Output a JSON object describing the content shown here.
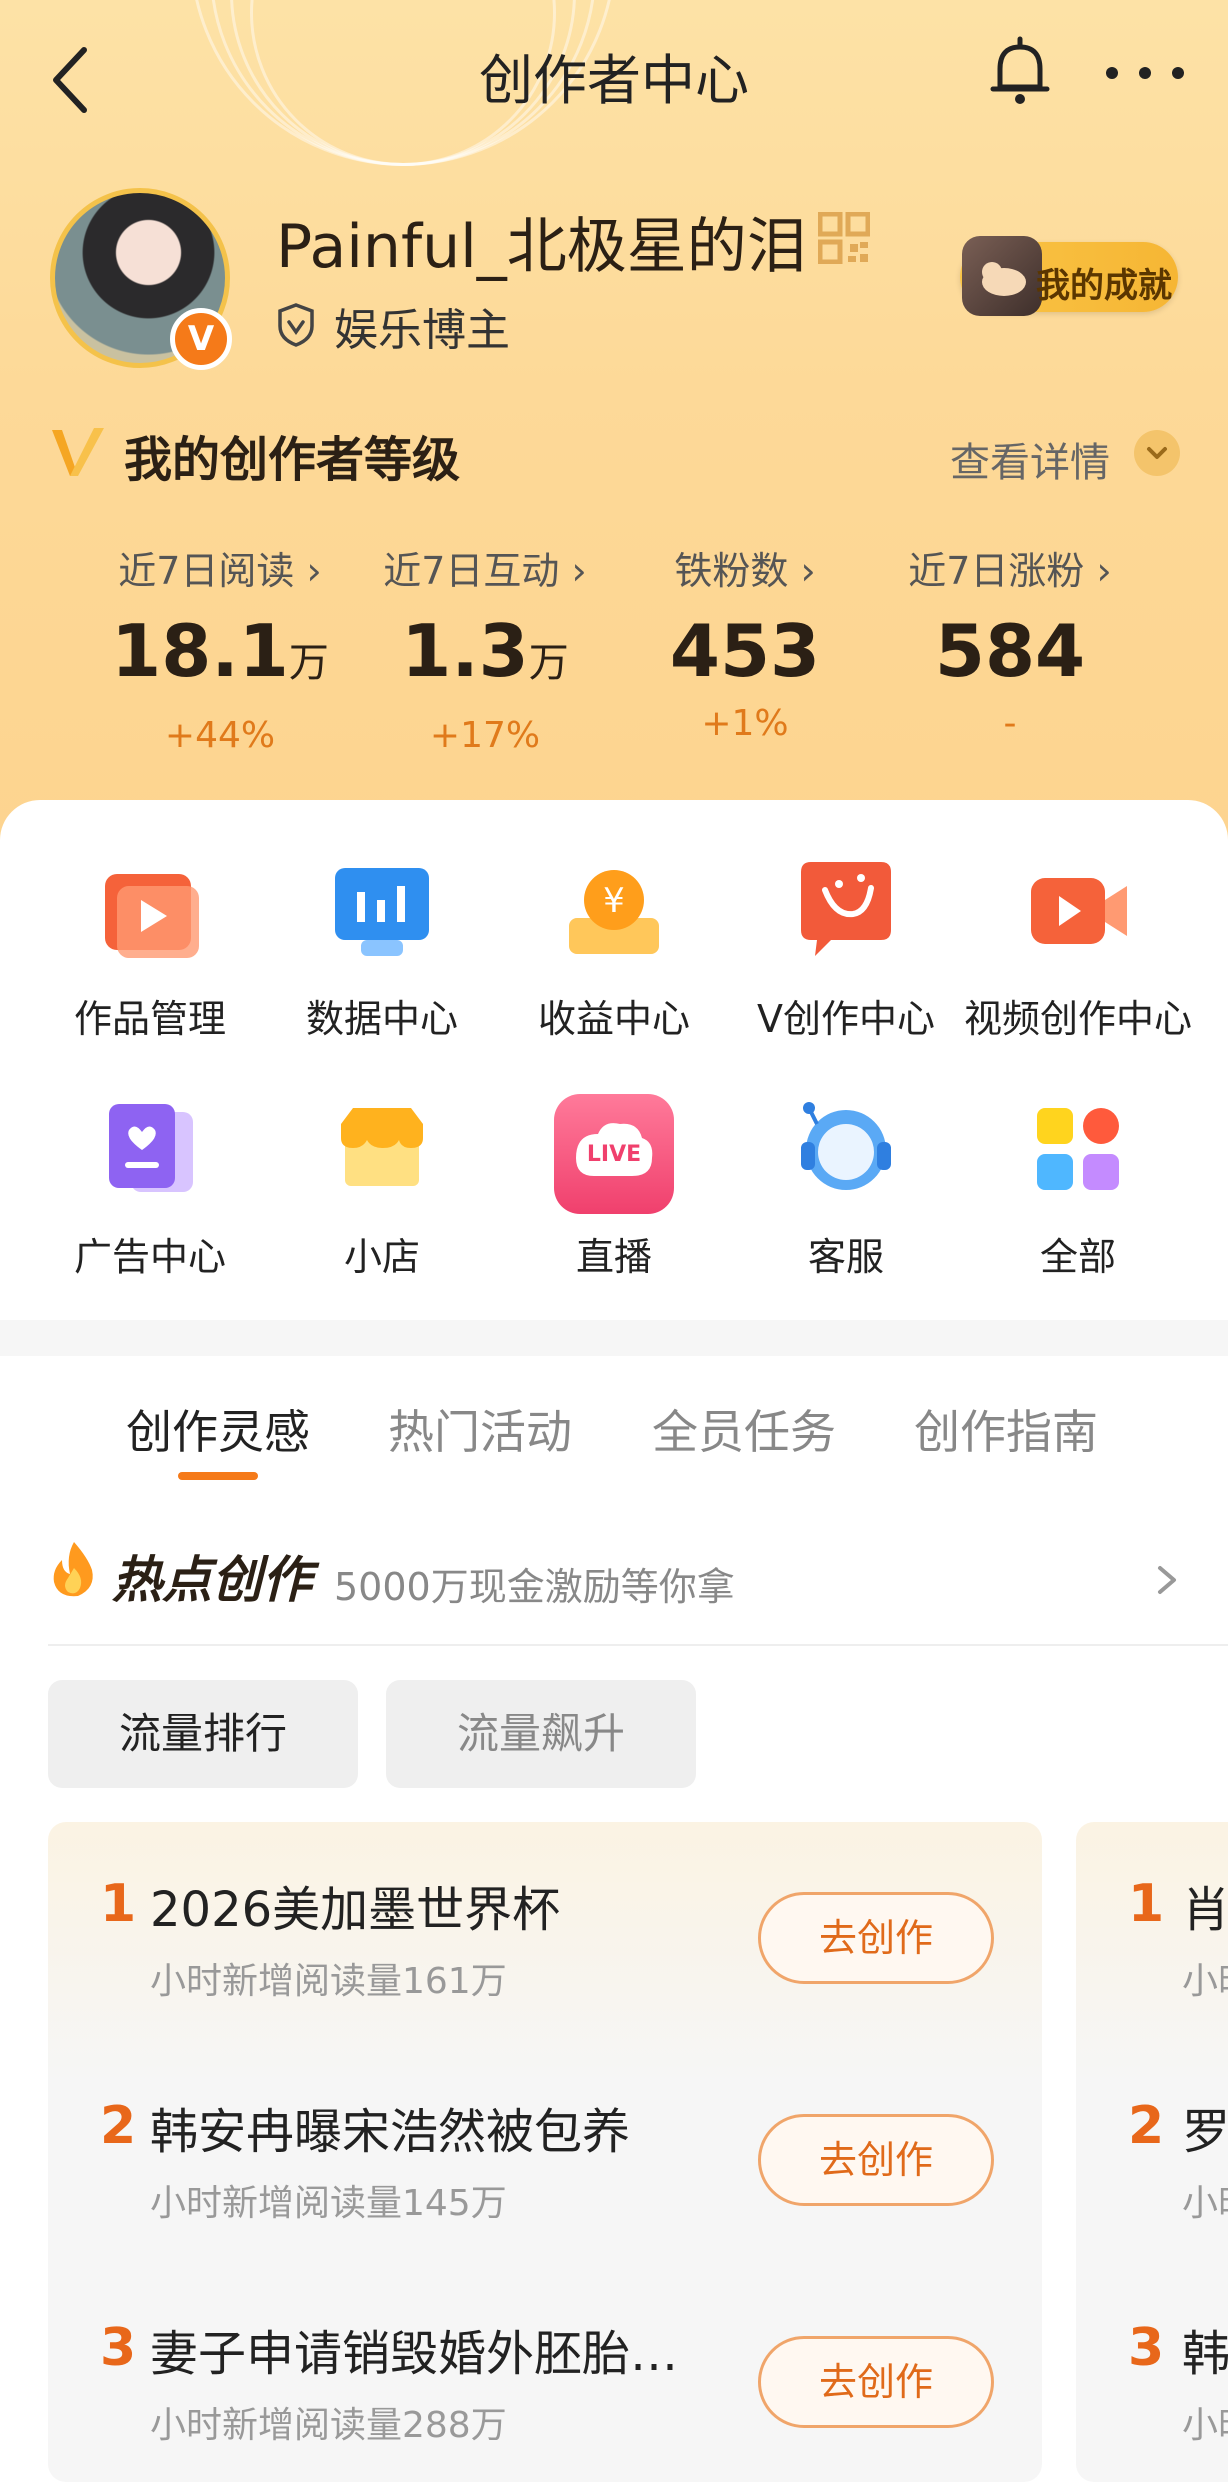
{
  "header": {
    "title": "创作者中心"
  },
  "profile": {
    "username": "Painful_北极星的泪",
    "badge_letter": "V",
    "role": "娱乐博主",
    "achievement_label": "我的成就"
  },
  "level": {
    "title": "我的创作者等级",
    "more_label": "查看详情"
  },
  "stats": [
    {
      "label": "近7日阅读",
      "value": "18.1",
      "unit": "万",
      "change": "+44%"
    },
    {
      "label": "近7日互动",
      "value": "1.3",
      "unit": "万",
      "change": "+17%"
    },
    {
      "label": "铁粉数",
      "value": "453",
      "unit": "",
      "change": "+1%"
    },
    {
      "label": "近7日涨粉",
      "value": "584",
      "unit": "",
      "change": "-"
    }
  ],
  "tools": [
    {
      "label": "作品管理",
      "icon": "play-folder-icon"
    },
    {
      "label": "数据中心",
      "icon": "data-monitor-icon"
    },
    {
      "label": "收益中心",
      "icon": "yen-coin-icon"
    },
    {
      "label": "V创作中心",
      "icon": "sparkle-bubble-icon"
    },
    {
      "label": "视频创作中心",
      "icon": "video-camera-icon"
    },
    {
      "label": "广告中心",
      "icon": "ad-card-icon"
    },
    {
      "label": "小店",
      "icon": "shop-icon"
    },
    {
      "label": "直播",
      "icon": "live-icon"
    },
    {
      "label": "客服",
      "icon": "support-headset-icon"
    },
    {
      "label": "全部",
      "icon": "all-grid-icon"
    }
  ],
  "live_icon_text": "LIVE",
  "tabs": [
    "创作灵感",
    "热门活动",
    "全员任务",
    "创作指南"
  ],
  "hot": {
    "title": "热点创作",
    "subtitle": "5000万现金激励等你拿"
  },
  "chips": [
    "流量排行",
    "流量飙升"
  ],
  "hot_list": [
    {
      "rank": "1",
      "title": "2026美加墨世界杯",
      "sub": "小时新增阅读量161万",
      "button": "去创作"
    },
    {
      "rank": "2",
      "title": "韩安冉曝宋浩然被包养",
      "sub": "小时新增阅读量145万",
      "button": "去创作"
    },
    {
      "rank": "3",
      "title": "妻子申请销毁婚外胚胎…",
      "sub": "小时新增阅读量288万",
      "button": "去创作"
    }
  ],
  "hot_list_2": [
    {
      "rank": "1",
      "title": "肖",
      "sub": "小时"
    },
    {
      "rank": "2",
      "title": "罗",
      "sub": "小时"
    },
    {
      "rank": "3",
      "title": "韩",
      "sub": "小时"
    }
  ],
  "colors": {
    "accent": "#f57a19",
    "header_bg": "#fdd998"
  }
}
